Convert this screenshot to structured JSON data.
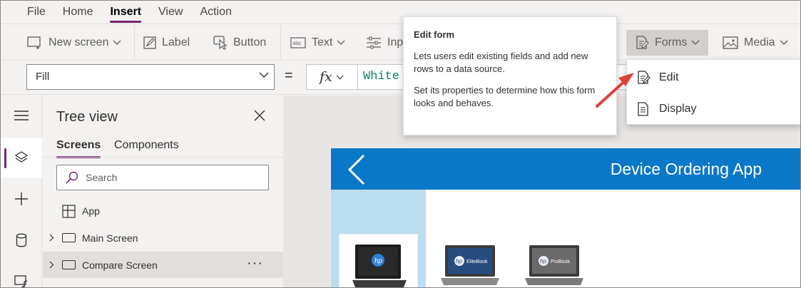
{
  "menu": {
    "items": [
      {
        "label": "File"
      },
      {
        "label": "Home"
      },
      {
        "label": "Insert",
        "active": true
      },
      {
        "label": "View"
      },
      {
        "label": "Action"
      }
    ]
  },
  "ribbon": {
    "new_screen": "New screen",
    "label": "Label",
    "button": "Button",
    "text": "Text",
    "input": "Inp",
    "forms": "Forms",
    "media": "Media"
  },
  "formula_bar": {
    "property": "Fill",
    "equals": "=",
    "fx": "fx",
    "formula": "White"
  },
  "tree_view": {
    "title": "Tree view",
    "tabs": [
      {
        "label": "Screens",
        "active": true
      },
      {
        "label": "Components"
      }
    ],
    "search_placeholder": "Search",
    "app_label": "App",
    "screens": [
      {
        "label": "Main Screen"
      },
      {
        "label": "Compare Screen",
        "selected": true
      }
    ],
    "more": "···"
  },
  "canvas": {
    "app_title": "Device Ordering App"
  },
  "forms_menu": {
    "items": [
      {
        "label": "Edit"
      },
      {
        "label": "Display"
      }
    ]
  },
  "tooltip": {
    "title": "Edit form",
    "line1": "Lets users edit existing fields and add new rows to a data source.",
    "line2": "Set its properties to determine how this form looks and behaves."
  },
  "colors": {
    "accent": "#742774",
    "app_header": "#0a78c8",
    "gallery_left": "#bcddf0",
    "arrow": "#e0403a"
  }
}
